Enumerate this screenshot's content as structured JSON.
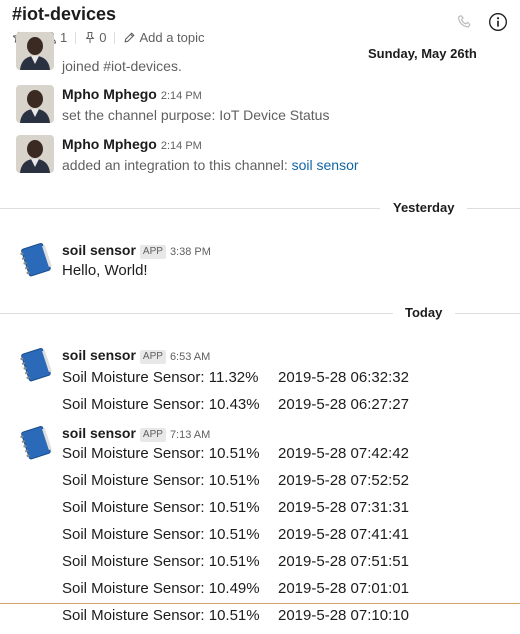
{
  "header": {
    "title": "#iot-devices",
    "members_count": "1",
    "pins_count": "0",
    "add_topic": "Add a topic"
  },
  "dividers": {
    "sunday": "Sunday, May 26th",
    "yesterday": "Yesterday",
    "today": "Today"
  },
  "messages": {
    "joined_text": "joined #iot-devices.",
    "m1": {
      "user": "Mpho Mphego",
      "time": "2:14 PM",
      "text": "set the channel purpose: IoT Device Status"
    },
    "m2": {
      "user": "Mpho Mphego",
      "time": "2:14 PM",
      "text": "added an integration to this channel: ",
      "link": "soil sensor"
    },
    "m3": {
      "user": "soil sensor",
      "badge": "APP",
      "time": "3:38 PM",
      "text": "Hello, World!"
    },
    "m4": {
      "user": "soil sensor",
      "badge": "APP",
      "time": "6:53 AM"
    },
    "m5": {
      "user": "soil sensor",
      "badge": "APP",
      "time": "7:13 AM"
    }
  },
  "readings": [
    {
      "label": "Soil Moisture Sensor: 11.32%",
      "ts": "2019-5-28 06:32:32"
    },
    {
      "label": "Soil Moisture Sensor: 10.43%",
      "ts": "2019-5-28 06:27:27"
    },
    {
      "label": "Soil Moisture Sensor: 10.51%",
      "ts": "2019-5-28 07:42:42"
    },
    {
      "label": "Soil Moisture Sensor: 10.51%",
      "ts": "2019-5-28 07:52:52"
    },
    {
      "label": "Soil Moisture Sensor: 10.51%",
      "ts": "2019-5-28 07:31:31"
    },
    {
      "label": "Soil Moisture Sensor: 10.51%",
      "ts": "2019-5-28 07:41:41"
    },
    {
      "label": "Soil Moisture Sensor: 10.51%",
      "ts": "2019-5-28 07:51:51"
    },
    {
      "label": "Soil Moisture Sensor: 10.49%",
      "ts": "2019-5-28 07:01:01"
    },
    {
      "label": "Soil Moisture Sensor: 10.51%",
      "ts": "2019-5-28 07:10:10"
    }
  ],
  "colors": {
    "link": "#1264a3",
    "new_message_line": "#d4a06a",
    "divider": "#dddddd"
  },
  "icons": [
    "star-icon",
    "person-icon",
    "pin-icon",
    "pencil-icon",
    "phone-icon",
    "info-icon",
    "user-avatar",
    "notebook-app-icon"
  ]
}
